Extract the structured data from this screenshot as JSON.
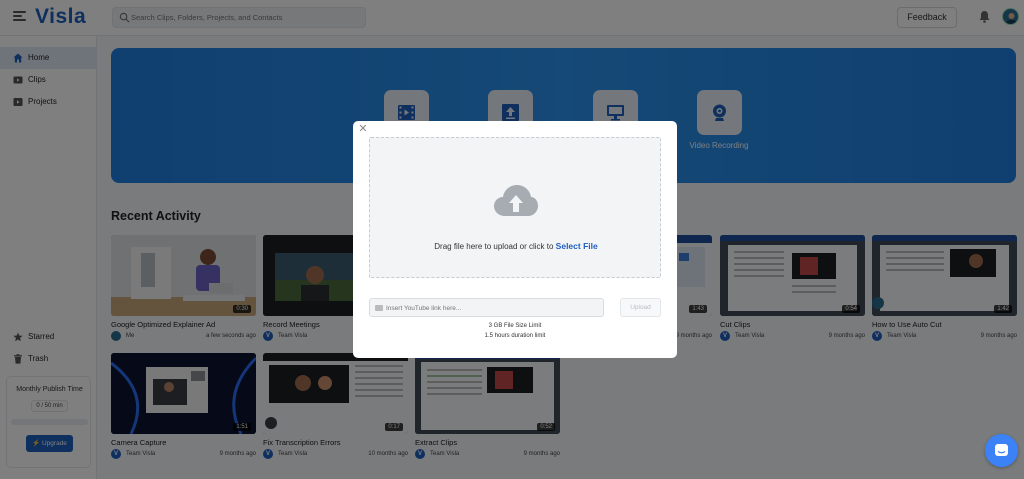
{
  "header": {
    "logo": "Visla",
    "search_placeholder": "Search Clips, Folders, Projects, and Contacts",
    "feedback_label": "Feedback"
  },
  "sidebar": {
    "items": [
      {
        "label": "Home",
        "icon": "home-icon",
        "active": true
      },
      {
        "label": "Clips",
        "icon": "clips-icon"
      },
      {
        "label": "Projects",
        "icon": "projects-icon"
      },
      {
        "label": "Starred",
        "icon": "star-icon"
      },
      {
        "label": "Trash",
        "icon": "trash-icon"
      }
    ],
    "publish": {
      "title": "Monthly Publish Time",
      "value": "0 / 50 min",
      "progress_fraction": 0,
      "upgrade_label": "Upgrade"
    }
  },
  "banner": {
    "tiles": [
      {
        "label": "",
        "icon": "video-film-icon"
      },
      {
        "label": "",
        "icon": "upload-icon"
      },
      {
        "label": "",
        "icon": "screen-record-icon"
      },
      {
        "label": "Video Recording",
        "icon": "webcam-icon"
      }
    ]
  },
  "recent": {
    "title": "Recent Activity",
    "cards": [
      {
        "title": "Google Optimized Explainer Ad",
        "owner": "Me",
        "time": "a few seconds ago",
        "duration": "0:30",
        "avatar": "photo"
      },
      {
        "title": "Record Meetings",
        "owner": "Team Visla",
        "time": "",
        "duration": "",
        "avatar": "V"
      },
      {
        "title": "",
        "owner": "",
        "time": "9 months ago",
        "duration": "1:43",
        "avatar": ""
      },
      {
        "title": "Cut Clips",
        "owner": "Team Visla",
        "time": "9 months ago",
        "duration": "0:54",
        "avatar": "V"
      },
      {
        "title": "How to Use Auto Cut",
        "owner": "Team Visla",
        "time": "9 months ago",
        "duration": "1:42",
        "avatar": "V"
      },
      {
        "title": "Camera Capture",
        "owner": "Team Visla",
        "time": "9 months ago",
        "duration": "1:51",
        "avatar": "V"
      },
      {
        "title": "Fix Transcription Errors",
        "owner": "Team Visla",
        "time": "10 months ago",
        "duration": "0:17",
        "avatar": "V"
      },
      {
        "title": "Extract Clips",
        "owner": "Team Visla",
        "time": "9 months ago",
        "duration": "0:52",
        "avatar": "V"
      }
    ]
  },
  "modal": {
    "drop_text": "Drag file here to upload or click to",
    "select_file_label": "Select File",
    "youtube_placeholder": "Insert YouTube link here...",
    "upload_label": "Upload",
    "size_limit": "3 GB File Size Limit",
    "duration_limit": "1.5 hours duration limit"
  },
  "colors": {
    "brand": "#1f5fbf",
    "banner": "#2b92ec",
    "overlay": "rgba(0,0,0,0.5)"
  }
}
